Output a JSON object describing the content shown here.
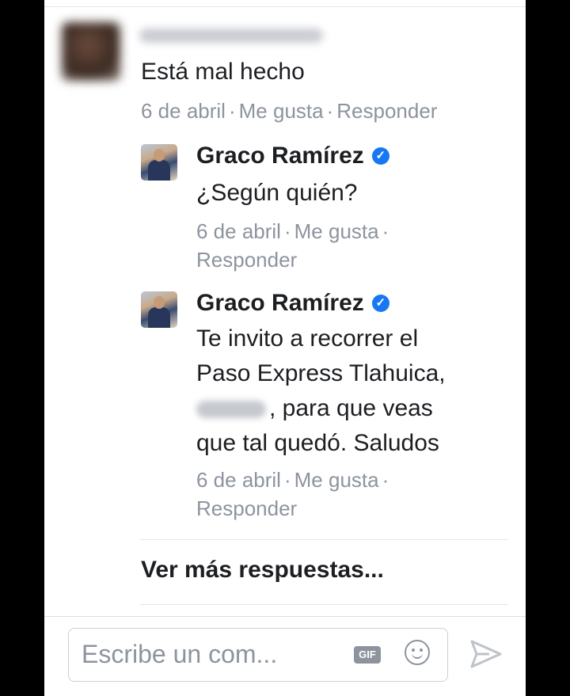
{
  "top_comment": {
    "text": "Está mal hecho",
    "date": "6 de abril",
    "like": "Me gusta",
    "reply": "Responder"
  },
  "replies": [
    {
      "name": "Graco Ramírez",
      "text": "¿Según quién?",
      "date": "6 de abril",
      "like": "Me gusta",
      "reply": "Responder"
    },
    {
      "name": "Graco Ramírez",
      "text_lines": [
        "Te invito a recorrer el",
        "Paso Express Tlahuica,",
        ", para que veas",
        "que tal quedó. Saludos"
      ],
      "date": "6 de abril",
      "like": "Me gusta",
      "reply": "Responder"
    }
  ],
  "separator": "·",
  "more_replies": "Ver más respuestas...",
  "composer": {
    "placeholder": "Escribe un com...",
    "gif_label": "GIF"
  },
  "icons": [
    "verified-badge-icon",
    "gif-icon",
    "emoji-icon",
    "send-icon"
  ],
  "colors": {
    "text": "#1c1e21",
    "meta": "#8d949e",
    "verified": "#1877f2"
  }
}
